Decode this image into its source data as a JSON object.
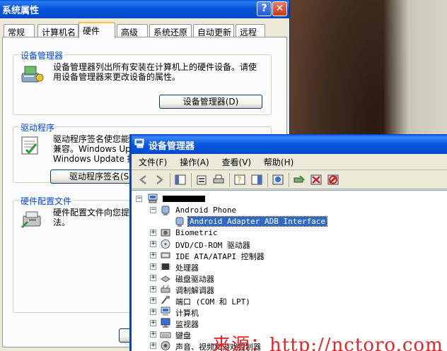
{
  "system_properties": {
    "title": "系统属性",
    "help_button": "?",
    "close_button": "✕",
    "tabs": [
      {
        "label": "常规"
      },
      {
        "label": "计算机名"
      },
      {
        "label": "硬件",
        "active": true
      },
      {
        "label": "高级"
      },
      {
        "label": "系统还原"
      },
      {
        "label": "自动更新"
      },
      {
        "label": "远程"
      }
    ],
    "device_manager_group": {
      "title": "设备管理器",
      "description_line1": "设备管理器列出所有安装在计算机上的硬件设备。请使",
      "description_line2": "用设备管理器来更改设备的属性。",
      "button": "设备管理器(D)"
    },
    "drivers_group": {
      "title": "驱动程序",
      "description_line1": "驱动程序签名使您能",
      "description_line2": "兼容。Windows Upda",
      "description_line3": "Windows Update 搜",
      "button": "驱动程序签名(S"
    },
    "hardware_profiles_group": {
      "title": "硬件配置文件",
      "description_line1": "硬件配置文件向您提",
      "description_line2": "法。"
    }
  },
  "device_manager": {
    "title": "设备管理器",
    "menu": [
      "文件(F)",
      "操作(A)",
      "查看(V)",
      "帮助(H)"
    ],
    "toolbar_icons": [
      "back-icon",
      "forward-icon",
      "show-hide-console-tree-icon",
      "properties-icon",
      "print-icon",
      "help-icon",
      "show-hide-action-pane-icon",
      "scan-hardware-icon",
      "update-driver-icon",
      "disable-device-icon",
      "uninstall-device-icon"
    ],
    "tree": {
      "root_label": "",
      "nodes": [
        {
          "label": "Android Phone",
          "expanded": true,
          "icon": "phone-device-icon"
        },
        {
          "label": "Android Adapter ADB Interface",
          "child": true,
          "selected": true,
          "icon": "adb-interface-icon"
        },
        {
          "label": "Biometric",
          "icon": "biometric-icon"
        },
        {
          "label": "DVD/CD-ROM 驱动器",
          "icon": "dvd-drive-icon"
        },
        {
          "label": "IDE ATA/ATAPI 控制器",
          "icon": "ide-controller-icon"
        },
        {
          "label": "处理器",
          "icon": "processor-icon"
        },
        {
          "label": "磁盘驱动器",
          "icon": "disk-drive-icon"
        },
        {
          "label": "调制解调器",
          "icon": "modem-icon"
        },
        {
          "label": "端口 (COM 和 LPT)",
          "icon": "port-icon"
        },
        {
          "label": "计算机",
          "icon": "computer-icon"
        },
        {
          "label": "监视器",
          "icon": "monitor-icon"
        },
        {
          "label": "键盘",
          "icon": "keyboard-icon"
        },
        {
          "label": "声音、视频和游戏控制器",
          "icon": "sound-icon"
        }
      ]
    }
  },
  "watermark": "来源：http://nctoro.com"
}
